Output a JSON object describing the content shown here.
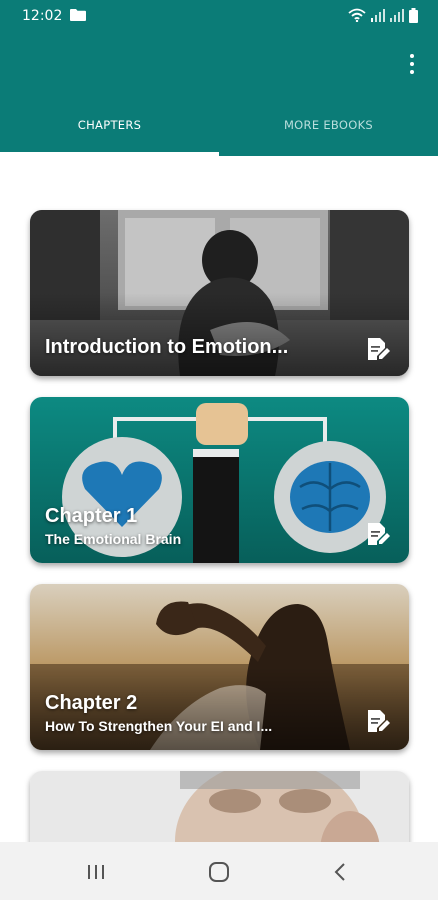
{
  "status_bar": {
    "time": "12:02",
    "icons": [
      "folder-icon",
      "wifi-icon",
      "signal-icon",
      "signal-icon",
      "battery-icon"
    ]
  },
  "app_bar": {
    "menu_icon": "more-vert-icon",
    "tabs": [
      {
        "label": "CHAPTERS",
        "selected": true
      },
      {
        "label": "MORE EBOOKS",
        "selected": false
      }
    ]
  },
  "cards": [
    {
      "title": "Introduction to Emotion...",
      "subtitle": "",
      "icon": "edit-note-icon",
      "image": "woman-at-window-photo"
    },
    {
      "title": "Chapter 1",
      "subtitle": "The Emotional Brain",
      "icon": "edit-note-icon",
      "image": "heart-brain-balance-illustration"
    },
    {
      "title": "Chapter 2",
      "subtitle": "How To Strengthen Your EI and I...",
      "icon": "edit-note-icon",
      "image": "heart-hands-sunset-photo"
    },
    {
      "title": "",
      "subtitle": "",
      "icon": "",
      "image": "man-portrait-photo"
    }
  ],
  "colors": {
    "primary": "#0b7c77",
    "tab_selected": "#ffffff",
    "tab_unselected": "#b9dedc",
    "nav_bar": "#f2f2f2"
  },
  "nav_bar": {
    "buttons": [
      "recents-icon",
      "home-icon",
      "back-icon"
    ]
  }
}
